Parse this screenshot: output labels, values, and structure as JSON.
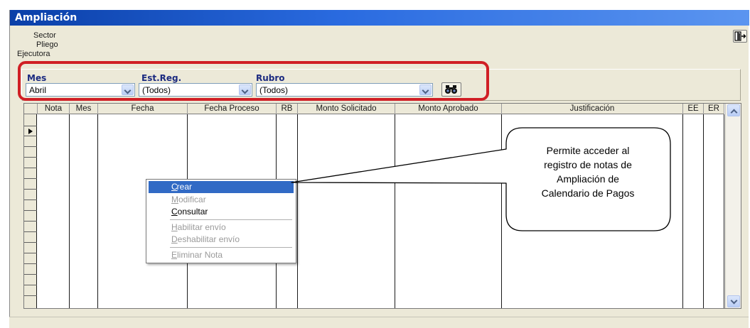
{
  "window": {
    "title": "Ampliación"
  },
  "header": {
    "sector_label": "Sector",
    "pliego_label": "Pliego",
    "ejecutora_label": "Ejecutora"
  },
  "filters": {
    "mes": {
      "label": "Mes",
      "value": "Abril"
    },
    "est_reg": {
      "label": "Est.Reg.",
      "value": "(Todos)"
    },
    "rubro": {
      "label": "Rubro",
      "value": "(Todos)"
    }
  },
  "grid": {
    "columns": [
      "Nota",
      "Mes",
      "Fecha",
      "Fecha Proceso",
      "RB",
      "Monto Solicitado",
      "Monto Aprobado",
      "Justificación",
      "EE",
      "ER"
    ]
  },
  "context_menu": {
    "items": [
      {
        "label": "Crear",
        "state": "selected"
      },
      {
        "label": "Modificar",
        "state": "disabled"
      },
      {
        "label": "Consultar",
        "state": "enabled"
      },
      {
        "label": "Habilitar envío",
        "state": "disabled"
      },
      {
        "label": "Deshabilitar envío",
        "state": "disabled"
      },
      {
        "label": "Eliminar Nota",
        "state": "disabled"
      }
    ]
  },
  "callout": {
    "lines": [
      "Permite acceder al",
      "registro de notas de",
      "Ampliación de",
      "Calendario de Pagos"
    ]
  },
  "colors": {
    "highlight": "#d01f25",
    "selection": "#316ac5",
    "title_bar": "#0a3fa8"
  },
  "icons": {
    "exit": "exit-door-icon",
    "search": "binoculars-icon"
  }
}
